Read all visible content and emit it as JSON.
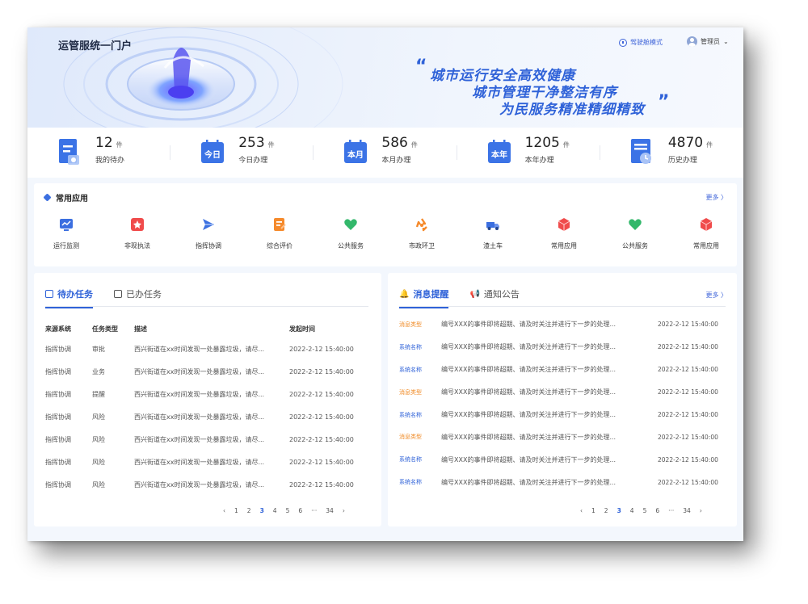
{
  "header": {
    "title": "运管服统一门户",
    "cockpit_label": "驾驶舱模式",
    "user_label": "管理员",
    "slogan_lines": [
      "城市运行安全高效健康",
      "城市管理干净整洁有序",
      "为民服务精准精细精致"
    ]
  },
  "stats": [
    {
      "value": "12",
      "unit": "件",
      "label": "我的待办",
      "icon": "doc-icon"
    },
    {
      "value": "253",
      "unit": "件",
      "label": "今日办理",
      "icon": "calendar-today-icon",
      "badge": "今日"
    },
    {
      "value": "586",
      "unit": "件",
      "label": "本月办理",
      "icon": "calendar-month-icon",
      "badge": "本月"
    },
    {
      "value": "1205",
      "unit": "件",
      "label": "本年办理",
      "icon": "calendar-year-icon",
      "badge": "本年"
    },
    {
      "value": "4870",
      "unit": "件",
      "label": "历史办理",
      "icon": "history-icon"
    }
  ],
  "apps": {
    "title": "常用应用",
    "more": "更多 〉",
    "items": [
      {
        "label": "运行监测",
        "icon": "monitor-icon",
        "color": "#3b6fe0"
      },
      {
        "label": "非现执法",
        "icon": "law-icon",
        "color": "#f04b4b"
      },
      {
        "label": "指挥协调",
        "icon": "dispatch-icon",
        "color": "#3b6fe0"
      },
      {
        "label": "综合评价",
        "icon": "evaluate-icon",
        "color": "#f58a2c"
      },
      {
        "label": "公共服务",
        "icon": "heart-icon",
        "color": "#33b86b"
      },
      {
        "label": "市政环卫",
        "icon": "recycle-icon",
        "color": "#f58a2c"
      },
      {
        "label": "渣土车",
        "icon": "truck-icon",
        "color": "#3b6fe0"
      },
      {
        "label": "常用应用",
        "icon": "cube-icon",
        "color": "#f04b4b"
      },
      {
        "label": "公共服务",
        "icon": "heart-icon",
        "color": "#33b86b"
      },
      {
        "label": "常用应用",
        "icon": "cube-icon",
        "color": "#f04b4b"
      }
    ]
  },
  "tasks": {
    "tabs": [
      "待办任务",
      "已办任务"
    ],
    "columns": [
      "来源系统",
      "任务类型",
      "描述",
      "发起时间"
    ],
    "rows": [
      [
        "指挥协调",
        "审批",
        "西兴街道在xx时间发现一处暴露垃圾，请尽...",
        "2022-2-12 15:40:00"
      ],
      [
        "指挥协调",
        "业务",
        "西兴街道在xx时间发现一处暴露垃圾，请尽...",
        "2022-2-12 15:40:00"
      ],
      [
        "指挥协调",
        "提醒",
        "西兴街道在xx时间发现一处暴露垃圾，请尽...",
        "2022-2-12 15:40:00"
      ],
      [
        "指挥协调",
        "风险",
        "西兴街道在xx时间发现一处暴露垃圾，请尽...",
        "2022-2-12 15:40:00"
      ],
      [
        "指挥协调",
        "风险",
        "西兴街道在xx时间发现一处暴露垃圾，请尽...",
        "2022-2-12 15:40:00"
      ],
      [
        "指挥协调",
        "风险",
        "西兴街道在xx时间发现一处暴露垃圾，请尽...",
        "2022-2-12 15:40:00"
      ],
      [
        "指挥协调",
        "风险",
        "西兴街道在xx时间发现一处暴露垃圾，请尽...",
        "2022-2-12 15:40:00"
      ]
    ],
    "pager": [
      "‹",
      "1",
      "2",
      "3",
      "4",
      "5",
      "6",
      "···",
      "34",
      "›"
    ],
    "current_page": "3"
  },
  "messages": {
    "tabs": [
      "消息提醒",
      "通知公告"
    ],
    "more": "更多 〉",
    "rows": [
      {
        "tag": "消息类型",
        "tag_color": "orange",
        "text": "编号XXX的事件即将超期、请及时关注并进行下一步的处理...",
        "time": "2022-2-12 15:40:00"
      },
      {
        "tag": "系统名称",
        "tag_color": "blue",
        "text": "编号XXX的事件即将超期、请及时关注并进行下一步的处理...",
        "time": "2022-2-12 15:40:00"
      },
      {
        "tag": "系统名称",
        "tag_color": "blue",
        "text": "编号XXX的事件即将超期、请及时关注并进行下一步的处理...",
        "time": "2022-2-12 15:40:00"
      },
      {
        "tag": "消息类型",
        "tag_color": "orange",
        "text": "编号XXX的事件即将超期、请及时关注并进行下一步的处理...",
        "time": "2022-2-12 15:40:00"
      },
      {
        "tag": "系统名称",
        "tag_color": "blue",
        "text": "编号XXX的事件即将超期、请及时关注并进行下一步的处理...",
        "time": "2022-2-12 15:40:00"
      },
      {
        "tag": "消息类型",
        "tag_color": "orange",
        "text": "编号XXX的事件即将超期、请及时关注并进行下一步的处理...",
        "time": "2022-2-12 15:40:00"
      },
      {
        "tag": "系统名称",
        "tag_color": "blue",
        "text": "编号XXX的事件即将超期、请及时关注并进行下一步的处理...",
        "time": "2022-2-12 15:40:00"
      },
      {
        "tag": "系统名称",
        "tag_color": "blue",
        "text": "编号XXX的事件即将超期、请及时关注并进行下一步的处理...",
        "time": "2022-2-12 15:40:00"
      }
    ],
    "pager": [
      "‹",
      "1",
      "2",
      "3",
      "4",
      "5",
      "6",
      "···",
      "34",
      "›"
    ],
    "current_page": "3"
  },
  "colors": {
    "accent": "#2f62d8",
    "orange": "#f08a24",
    "bg": "#f3f7fd"
  }
}
